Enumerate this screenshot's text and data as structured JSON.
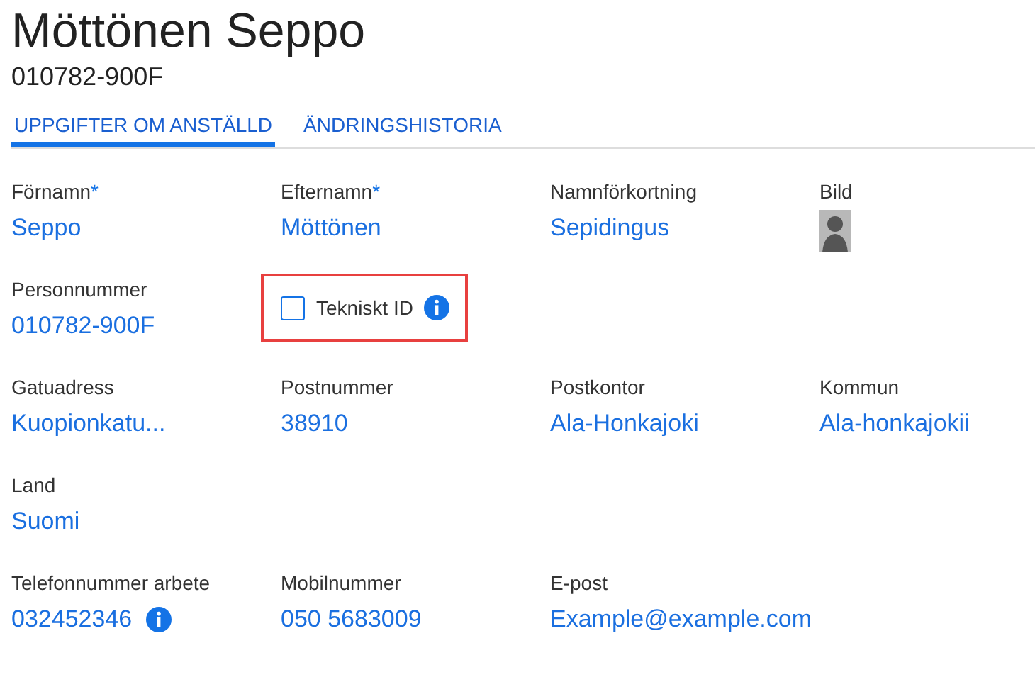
{
  "header": {
    "title": "Möttönen Seppo",
    "subtitle": "010782-900F"
  },
  "tabs": [
    {
      "label": "UPPGIFTER OM ANSTÄLLD",
      "selected": true
    },
    {
      "label": "ÄNDRINGSHISTORIA",
      "selected": false
    }
  ],
  "rows": [
    [
      {
        "kind": "text",
        "label": "Förnamn",
        "required_mark": "*",
        "value": "Seppo"
      },
      {
        "kind": "text",
        "label": "Efternamn",
        "required_mark": "*",
        "value": "Möttönen"
      },
      {
        "kind": "text",
        "label": "Namnförkortning",
        "value": "Sepidingus"
      },
      {
        "kind": "avatar",
        "label": "Bild"
      }
    ],
    [
      {
        "kind": "text",
        "label": "Personnummer",
        "value": "010782-900F"
      },
      {
        "kind": "checkbox",
        "label": "Tekniskt ID",
        "checked": false,
        "info": true,
        "highlighted": true
      }
    ],
    [
      {
        "kind": "text",
        "label": "Gatuadress",
        "value": "Kuopionkatu..."
      },
      {
        "kind": "text",
        "label": "Postnummer",
        "value": "38910"
      },
      {
        "kind": "text",
        "label": "Postkontor",
        "value": "Ala-Honkajoki"
      },
      {
        "kind": "text",
        "label": "Kommun",
        "value": "Ala-honkajokii"
      }
    ],
    [
      {
        "kind": "text",
        "label": "Land",
        "value": "Suomi"
      }
    ],
    [
      {
        "kind": "text",
        "label": "Telefonnummer arbete",
        "value": "032452346",
        "info": true
      },
      {
        "kind": "text",
        "label": "Mobilnummer",
        "value": "050 5683009"
      },
      {
        "kind": "text",
        "label": "E-post",
        "value": "Example@example.com"
      }
    ]
  ]
}
